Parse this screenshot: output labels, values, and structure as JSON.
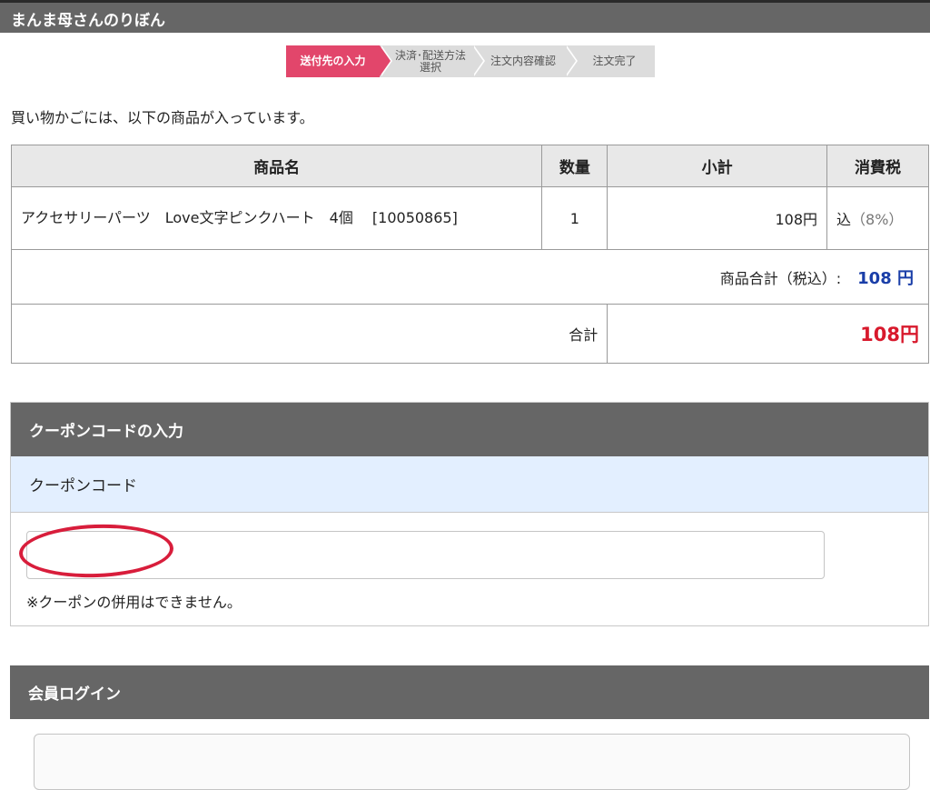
{
  "shop": {
    "name": "まんま母さんのりぼん"
  },
  "steps": [
    {
      "label": "送付先の入力",
      "active": true
    },
    {
      "label": "決済･配送方法\n選択",
      "active": false
    },
    {
      "label": "注文内容確認",
      "active": false
    },
    {
      "label": "注文完了",
      "active": false
    }
  ],
  "intro": "買い物かごには、以下の商品が入っています。",
  "cart": {
    "headers": {
      "name": "商品名",
      "qty": "数量",
      "subtotal": "小計",
      "tax": "消費税"
    },
    "items": [
      {
        "name": "アクセサリーパーツ　Love文字ピンクハート　4個　 [10050865]",
        "qty": "1",
        "subtotal": "108円",
        "tax_label": "込",
        "tax_rate": "（8%）"
      }
    ],
    "product_total_label": "商品合計（税込）:",
    "product_total_value": "108 円",
    "total_label": "合計",
    "total_value": "108円"
  },
  "coupon": {
    "title": "クーポンコードの入力",
    "label": "クーポンコード",
    "input_value": "",
    "note": "※クーポンの併用はできません。"
  },
  "login": {
    "title": "会員ログイン"
  },
  "colors": {
    "header_bg": "#666666",
    "step_active": "#e2466b",
    "total_red": "#d8192c",
    "sum_blue": "#1a3ea8",
    "coupon_label_bg": "#e3efff",
    "annotation_circle": "#d81d3b"
  }
}
